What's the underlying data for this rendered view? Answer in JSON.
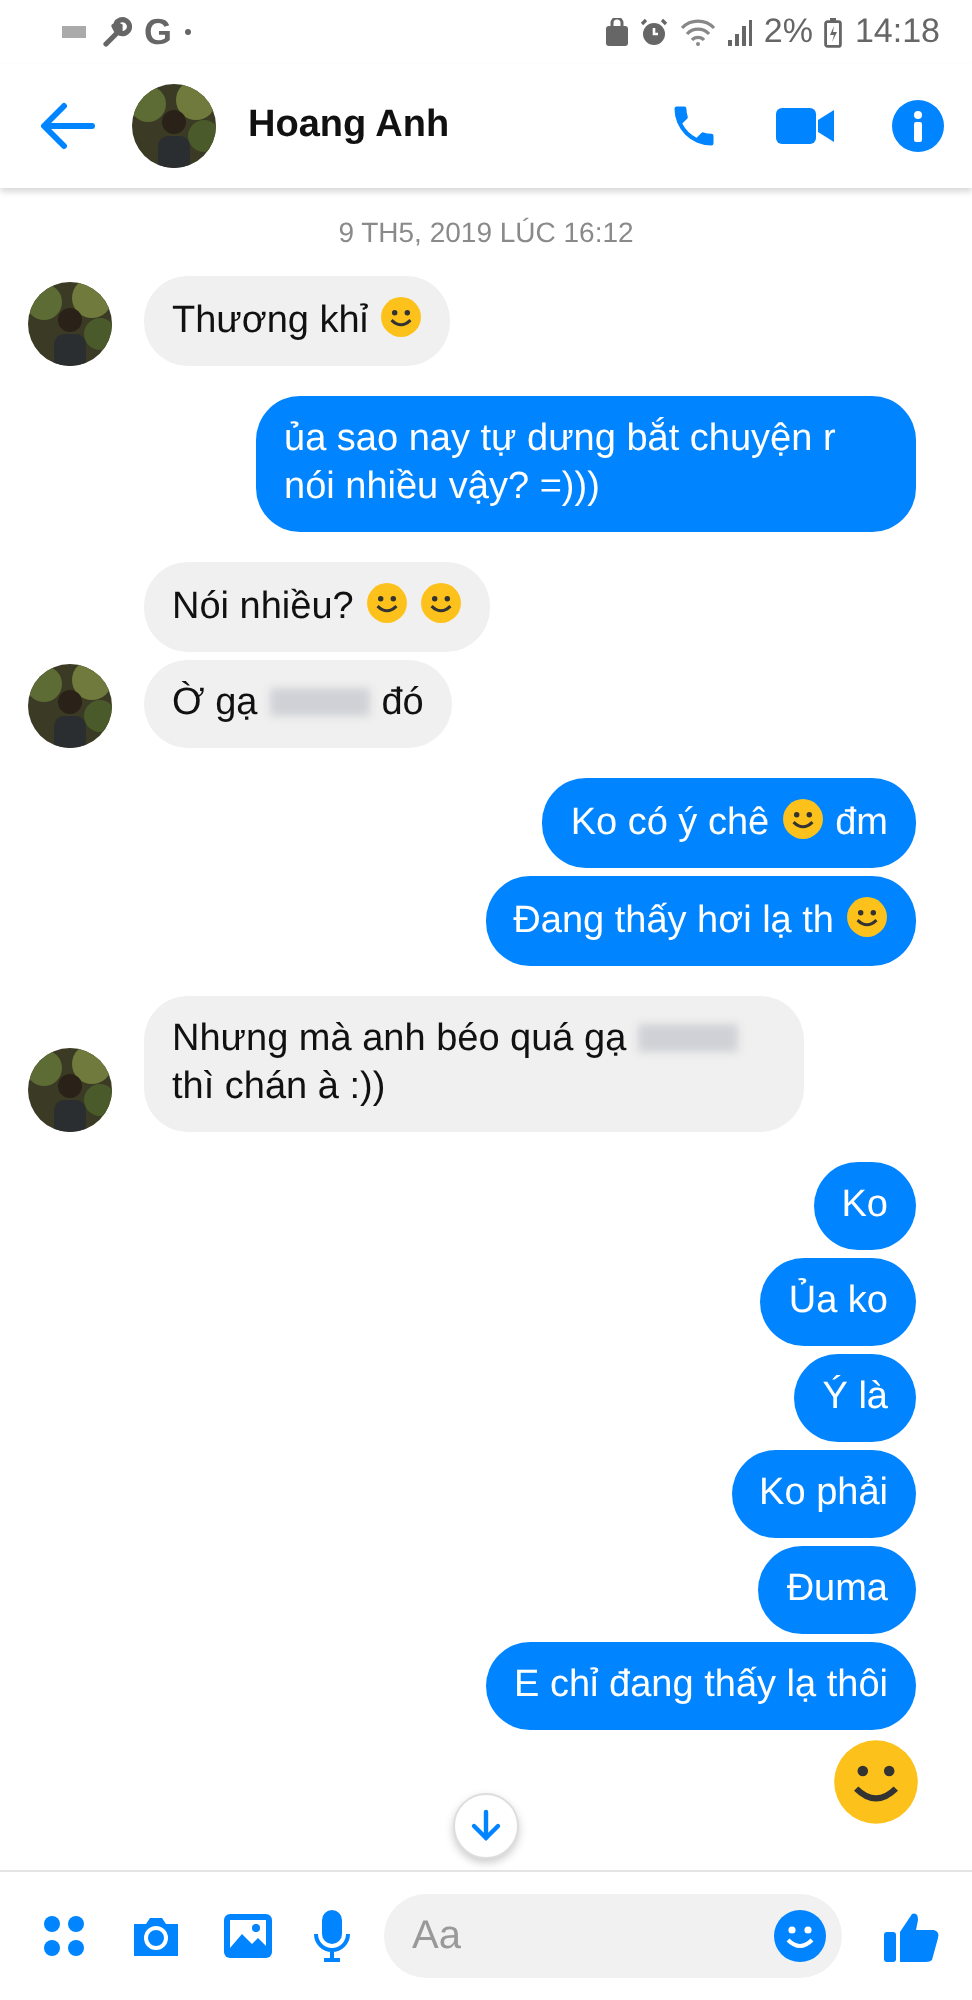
{
  "status_bar": {
    "app_letter": "G",
    "battery": "2%",
    "time": "14:18"
  },
  "header": {
    "contact": "Hoang Anh"
  },
  "date_divider": "9 TH5, 2019 LÚC 16:12",
  "groups": [
    {
      "kind": "in",
      "messages": [
        {
          "kind": "bubble",
          "parts": [
            {
              "kind": "text",
              "text": "Thương khỉ"
            },
            {
              "kind": "emoji"
            }
          ]
        }
      ]
    },
    {
      "kind": "out",
      "messages": [
        {
          "kind": "bubble",
          "parts": [
            {
              "kind": "text",
              "text": "ủa sao nay tự dưng bắt chuyện r nói nhiều vậy? =)))"
            }
          ]
        }
      ]
    },
    {
      "kind": "in",
      "messages": [
        {
          "kind": "bubble",
          "parts": [
            {
              "kind": "text",
              "text": "Nói nhiều?"
            },
            {
              "kind": "emoji"
            },
            {
              "kind": "emoji"
            }
          ]
        },
        {
          "kind": "bubble",
          "parts": [
            {
              "kind": "text",
              "text": "Ờ gạ"
            },
            {
              "kind": "blur"
            },
            {
              "kind": "text",
              "text": "đó"
            }
          ]
        }
      ]
    },
    {
      "kind": "out",
      "messages": [
        {
          "kind": "bubble",
          "parts": [
            {
              "kind": "text",
              "text": "Ko có ý chê"
            },
            {
              "kind": "emoji"
            },
            {
              "kind": "text",
              "text": "đm"
            }
          ]
        },
        {
          "kind": "bubble",
          "parts": [
            {
              "kind": "text",
              "text": "Đang thấy hơi lạ th"
            },
            {
              "kind": "emoji"
            }
          ]
        }
      ]
    },
    {
      "kind": "in",
      "messages": [
        {
          "kind": "bubble",
          "parts": [
            {
              "kind": "text",
              "text": "Nhưng mà anh béo quá gạ"
            },
            {
              "kind": "blur"
            },
            {
              "kind": "text",
              "text": "thì chán à :))"
            }
          ]
        }
      ]
    },
    {
      "kind": "out",
      "messages": [
        {
          "kind": "bubble",
          "parts": [
            {
              "kind": "text",
              "text": "Ko"
            }
          ]
        },
        {
          "kind": "bubble",
          "parts": [
            {
              "kind": "text",
              "text": "Ủa ko"
            }
          ]
        },
        {
          "kind": "bubble",
          "parts": [
            {
              "kind": "text",
              "text": "Ý là"
            }
          ]
        },
        {
          "kind": "bubble",
          "parts": [
            {
              "kind": "text",
              "text": "Ko phải"
            }
          ]
        },
        {
          "kind": "bubble",
          "parts": [
            {
              "kind": "text",
              "text": "Đuma"
            }
          ]
        },
        {
          "kind": "bubble",
          "parts": [
            {
              "kind": "text",
              "text": "E chỉ đang thấy lạ thôi"
            }
          ]
        },
        {
          "kind": "sticker"
        }
      ]
    }
  ],
  "composer": {
    "placeholder": "Aa"
  }
}
